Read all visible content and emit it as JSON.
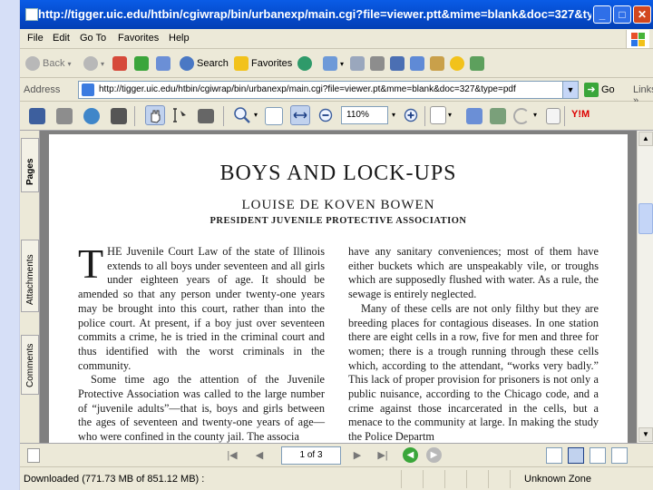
{
  "window": {
    "title": "http://tigger.uic.edu/htbin/cgiwrap/bin/urbanexp/main.cgi?file=viewer.ptt&mime=blank&doc=327&ty - ...",
    "minimize_glyph": "_",
    "maximize_glyph": "□",
    "close_glyph": "✕"
  },
  "menu": [
    "File",
    "Edit",
    "Go To",
    "Favorites",
    "Help"
  ],
  "toolbar": {
    "back_label": "Back",
    "search_label": "Search",
    "favorites_label": "Favorites"
  },
  "address": {
    "label": "Address",
    "url": "http://tigger.uic.edu/htbin/cgiwrap/bin/urbanexp/main.cgi?file=viewer.pt&mme=blank&doc=327&type=pdf",
    "go_label": "Go",
    "links_label": "Links",
    "chevron": "»"
  },
  "pdf_toolbar": {
    "zoom": "110%",
    "yahoo_label": "Y!M"
  },
  "side_tabs": {
    "pages": "Pages",
    "attachments": "Attachments",
    "comments": "Comments"
  },
  "document": {
    "title": "BOYS AND LOCK-UPS",
    "author": "LOUISE DE KOVEN BOWEN",
    "subtitle": "PRESIDENT JUVENILE PROTECTIVE ASSOCIATION",
    "dropcap": "T",
    "left_p1": "HE Juvenile Court Law of the state of Illinois extends to all boys under seventeen and all girls under eighteen years of age. It should be amended so that any person under twenty-one years may be brought into this court, rather than into the police court. At present, if a boy just over seventeen commits a crime, he is tried in the criminal court and thus identified with the worst criminals in the community.",
    "left_p2": "Some time ago the attention of the Juvenile Protective Association was called to the large number of “juvenile adults”—that is, boys and girls between the ages of seventeen and twenty-one years of age—who were confined in the county jail. The associa",
    "right_p1": "have any sanitary conveniences; most of them have either buckets which are unspeakably vile, or troughs which are supposedly flushed with water. As a rule, the sewage is entirely neglected.",
    "right_p2": "Many of these cells are not only filthy but they are breeding places for contagious diseases. In one station there are eight cells in a row, five for men and three for women; there is a trough running through these cells which, according to the attendant, “works very badly.” This lack of proper provision for prisoners is not only a public nuisance, according to the Chicago code, and a crime against those incarcerated in the cells, but a menace to the community at large. In making the study the Police Departm"
  },
  "navigation": {
    "page_indicator": "1 of 3"
  },
  "status": {
    "text": "Downloaded (771.73 MB of 851.12 MB) :",
    "zone": "Unknown Zone"
  }
}
